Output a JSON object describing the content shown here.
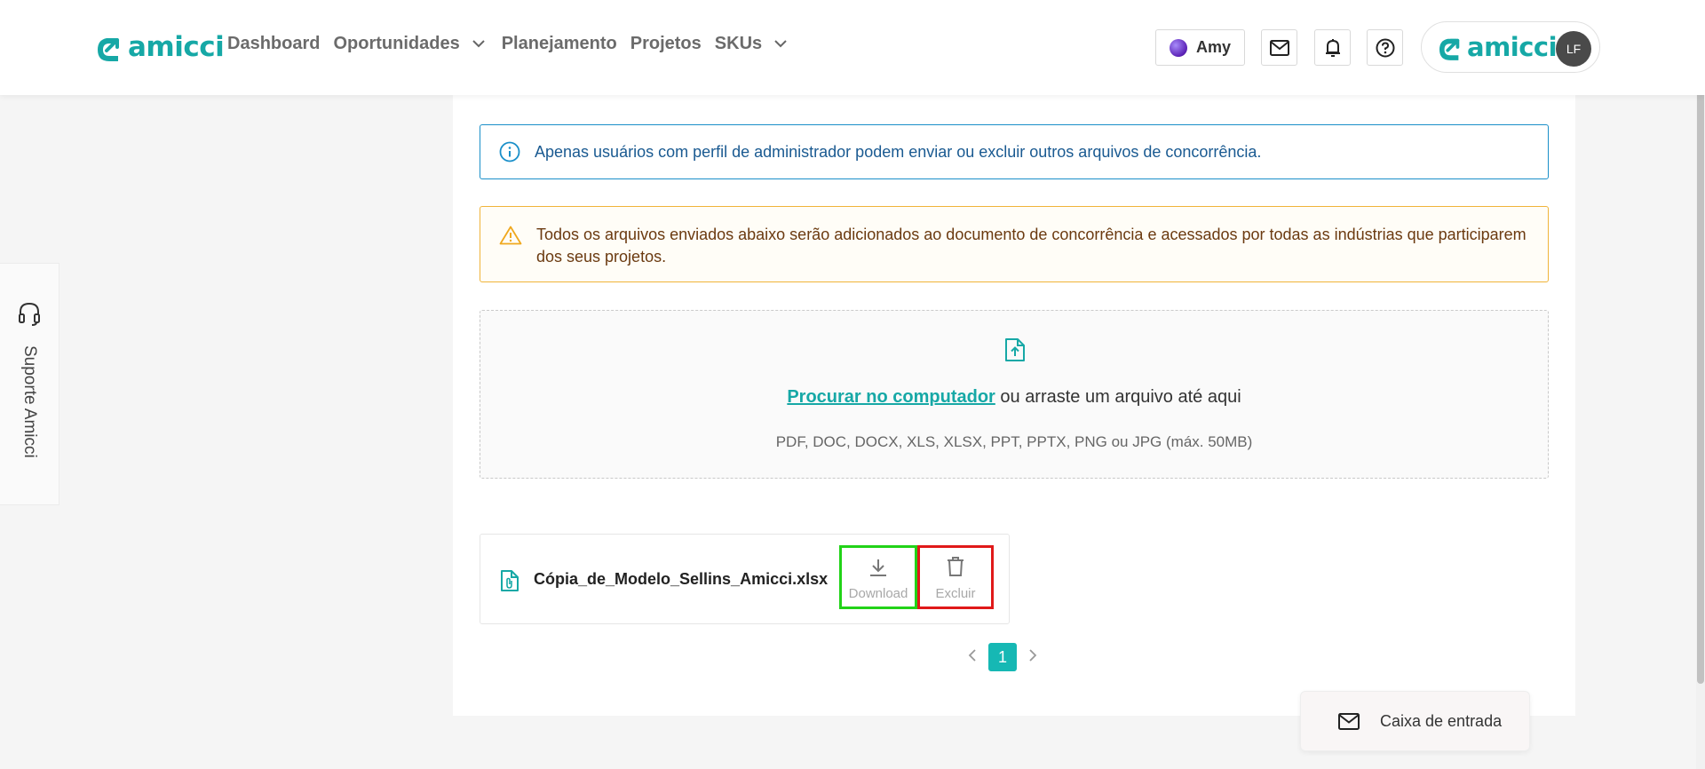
{
  "brand": {
    "name": "amicci",
    "accent": "#16a8a6"
  },
  "nav": {
    "items": [
      {
        "label": "Dashboard"
      },
      {
        "label": "Oportunidades"
      },
      {
        "label": "Planejamento"
      },
      {
        "label": "Projetos"
      },
      {
        "label": "SKUs"
      }
    ]
  },
  "header": {
    "user_name": "Amy",
    "account_logo": "amicci",
    "avatar_initials": "LF",
    "icons": [
      "mail-icon",
      "bell-icon",
      "help-icon"
    ]
  },
  "support": {
    "label": "Suporte Amicci",
    "icon": "headset-icon"
  },
  "alerts": {
    "info": "Apenas usuários com perfil de administrador podem enviar ou excluir outros arquivos de concorrência.",
    "warning": "Todos os arquivos enviados abaixo serão adicionados ao documento de concorrência e acessados por todas as indústrias que participarem dos seus projetos."
  },
  "upload": {
    "link_label": "Procurar no computador",
    "rest_label": " ou arraste um arquivo até aqui",
    "formats": "PDF, DOC, DOCX, XLS, XLSX, PPT, PPTX, PNG ou JPG (máx. 50MB)"
  },
  "files": [
    {
      "name": "Cópia_de_Modelo_Sellins_Amicci.xlsx",
      "download_label": "Download",
      "delete_label": "Excluir"
    }
  ],
  "pagination": {
    "current": "1"
  },
  "inbox": {
    "label": "Caixa de entrada"
  },
  "colors": {
    "info_border": "#1a8fc9",
    "warning_border": "#f0b43a",
    "download_highlight": "#22d318",
    "delete_highlight": "#e01919",
    "page_active": "#16b8b4"
  }
}
